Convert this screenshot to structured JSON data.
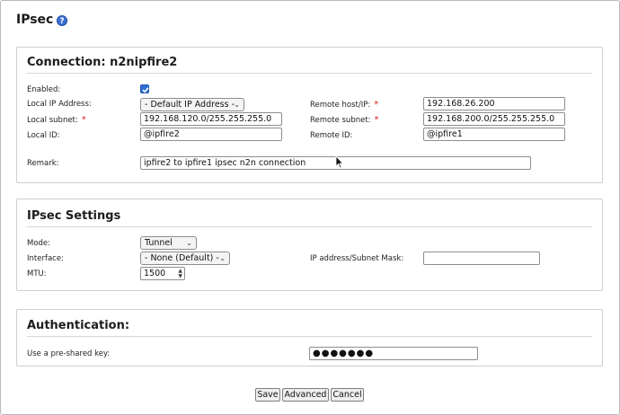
{
  "page": {
    "title": "IPsec",
    "help_icon": "?"
  },
  "connection": {
    "title": "Connection: n2nipfire2",
    "enabled_label": "Enabled:",
    "enabled": true,
    "local_ip_label": "Local IP Address:",
    "local_ip_value": "- Default IP Address -",
    "remote_host_label": "Remote host/IP:",
    "remote_host_value": "192.168.26.200",
    "local_subnet_label": "Local subnet:",
    "local_subnet_value": "192.168.120.0/255.255.255.0",
    "remote_subnet_label": "Remote subnet:",
    "remote_subnet_value": "192.168.200.0/255.255.255.0",
    "local_id_label": "Local ID:",
    "local_id_value": "@ipfire2",
    "remote_id_label": "Remote ID:",
    "remote_id_value": "@ipfire1",
    "remark_label": "Remark:",
    "remark_value": "ipfire2 to ipfire1 ipsec n2n connection",
    "required_mark": "*"
  },
  "ipsec_settings": {
    "title": "IPsec Settings",
    "mode_label": "Mode:",
    "mode_value": "Tunnel",
    "interface_label": "Interface:",
    "interface_value": "- None (Default) -",
    "ip_mask_label": "IP address/Subnet Mask:",
    "ip_mask_value": "",
    "mtu_label": "MTU:",
    "mtu_value": "1500"
  },
  "authentication": {
    "title": "Authentication:",
    "psk_label": "Use a pre-shared key:",
    "psk_value": "●●●●●●●"
  },
  "buttons": {
    "save": "Save",
    "advanced": "Advanced",
    "cancel": "Cancel"
  }
}
